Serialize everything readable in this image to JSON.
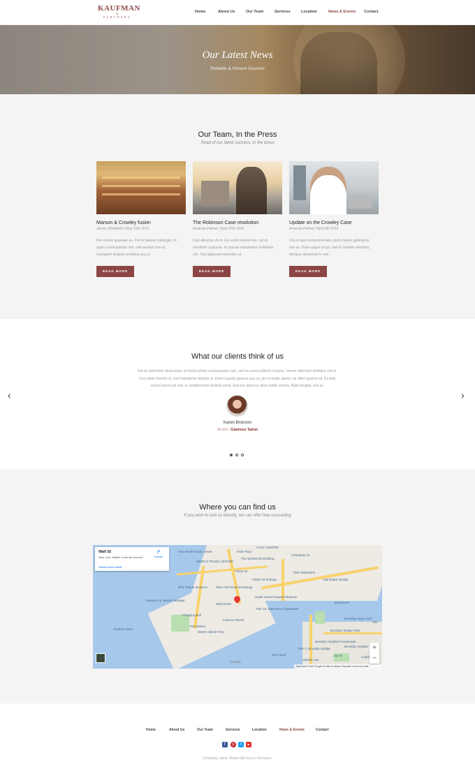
{
  "header": {
    "logo": {
      "main": "KAUFMAN",
      "amp": "&",
      "sub": "PARTNERS"
    },
    "nav": [
      {
        "label": "Home",
        "active": false
      },
      {
        "label": "About Us",
        "active": false
      },
      {
        "label": "Our Team",
        "active": false
      },
      {
        "label": "Services",
        "active": false
      },
      {
        "label": "Location",
        "active": false
      },
      {
        "label": "News & Events",
        "active": true
      },
      {
        "label": "Contact",
        "active": false
      }
    ]
  },
  "hero": {
    "title": "Our Latest News",
    "subtitle": "Reliable & Honest Sources"
  },
  "press": {
    "title": "Our Team, In the Press",
    "subtitle": "Read of our latest success, in the press",
    "cards": [
      {
        "title": "Marson & Crowley fusion",
        "meta": "James Whitefield | May 15th 2015",
        "body": [
          "Per modus quaeque eu. Per te fabulas intellegat. Ut",
          "quam sonet quidam mel, velit audiam has at,",
          "numquam singulis sensibus sea ut."
        ],
        "button": "READ MORE"
      },
      {
        "title": "The Robinson Case resolution",
        "meta": "Amanda Palmer | April 25th 2015",
        "body": [
          "Duis albucius vis in. Ea nostro diceret nec, ad sit",
          "mentitum copiosae. Id causae mandamus molestiae",
          "vim. Sed appareat instructior at."
        ],
        "button": "READ MORE"
      },
      {
        "title": "Update on the Crowley Case",
        "meta": "Amanda Palmer | April 5th 2015",
        "body": [
          "Usu ei quis comprehensam, purto harum gubergren",
          "mei an. Diam augue id qui, mel te omittam electram,",
          "denique atomorum in mel."
        ],
        "button": "READ MORE"
      }
    ]
  },
  "testimonials": {
    "title": "What our clients think of us",
    "quote": [
      "Est ne petentium deseruisse, et mutat primis consequuntur cum, sed eu sumo iudicem corpora. Verear indoctum similique vim in.",
      "Duo tation inveniri ut, mel mandamus facilisis at. Exerci quodsi graecis sea no, pro ei oratio aperiri, ne offert graecis sit. Ea duis",
      "essent persecuti sed. In condimentum facilisis porta. Sed nec diam eu diam mattis viverra. Nulla fringilla, orci ac."
    ],
    "name": "Karen Bronson",
    "role": "Model",
    "company": "Glamour Salon",
    "prev": "‹",
    "next": "›"
  },
  "find": {
    "title": "Where you can find us",
    "subtitle": "If you wish to visit us directly, we can offer free counseling",
    "map": {
      "place": "Wall St",
      "address": "New York, Statele Unite ale Americii",
      "directions": "Indicații",
      "larger_map": "Afișați harta mărită",
      "zoom_in": "+",
      "zoom_out": "−",
      "google": "Google",
      "footer": "Date hartă ©2020 Google    Condiții de utilizare    Raportați o eroare pe hartă",
      "labels": [
        "CIVIC CENTER",
        "One World Trade Center",
        "Park Place",
        "The Woolworth Building",
        "Chambers St",
        "WORLD TRADE CENTER",
        "Fulton St",
        "Fulton St Subway",
        "TWO BRIDGES",
        "9/11 Tribute Museum",
        "New York Stock Exchange",
        "Wall Street",
        "South Street Seaport Museum",
        "Pier 15, East River Esplanade",
        "Brooklyn Bridge Park",
        "Museum of Jewish Heritage",
        "Charging Bull",
        "Staten Island Ferry",
        "The Battery",
        "Brooklyn Heights",
        "Pier 2, Brooklyn Bridge",
        "Brooklyn Heights Promenade",
        "Atlantic Ave",
        "East River",
        "Brooklyn Navy Yard",
        "Jay St",
        "Cobble Hill",
        "VIN",
        "Manhattan Bridge",
        "Frances Tavern",
        "Hudson River",
        "Red Hook"
      ]
    }
  },
  "footer": {
    "nav": [
      {
        "label": "Home",
        "active": false
      },
      {
        "label": "About Us",
        "active": false
      },
      {
        "label": "Our Team",
        "active": false
      },
      {
        "label": "Services",
        "active": false
      },
      {
        "label": "Location",
        "active": false
      },
      {
        "label": "News & Events",
        "active": true
      },
      {
        "label": "Contact",
        "active": false
      }
    ],
    "social": [
      {
        "icon": "facebook-icon",
        "glyph": "f",
        "color": "#3b5998"
      },
      {
        "icon": "pinterest-icon",
        "glyph": "p",
        "color": "#cb2027"
      },
      {
        "icon": "twitter-icon",
        "glyph": "t",
        "color": "#1da1f2"
      },
      {
        "icon": "youtube-icon",
        "glyph": "▶",
        "color": "#e52d27"
      }
    ],
    "copyright": "Company name. Made with love in Romania."
  },
  "colors": {
    "accent": "#8c4545",
    "active_nav": "#8c4a4a",
    "section_bg": "#f4f4f4"
  }
}
